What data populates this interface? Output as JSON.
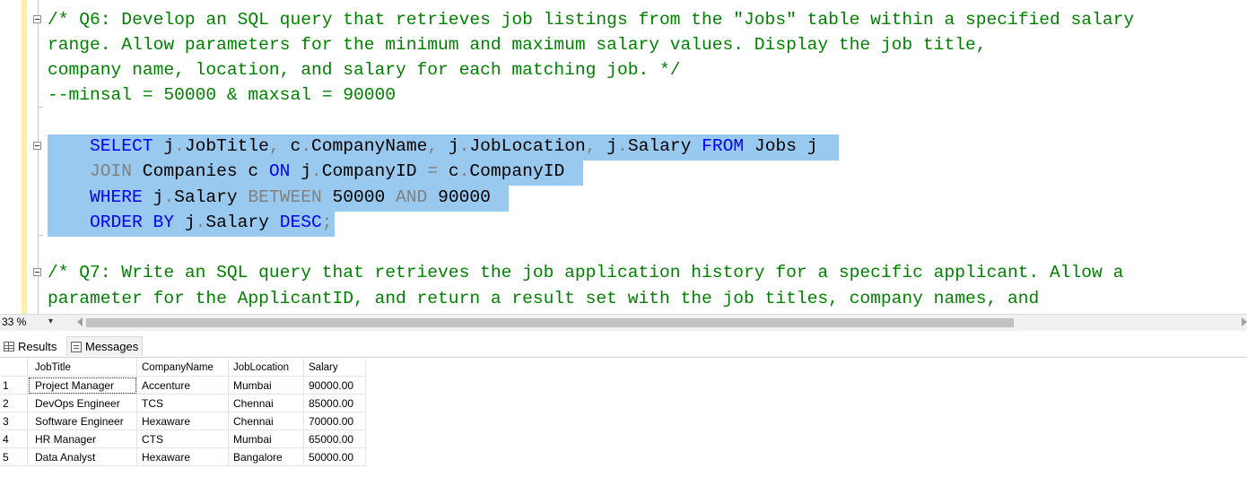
{
  "editor": {
    "q6_comment": [
      "/* Q6: Develop an SQL query that retrieves job listings from the \"Jobs\" table within a specified salary",
      "range. Allow parameters for the minimum and maximum salary values. Display the job title,",
      "company name, location, and salary for each matching job. */",
      "--minsal = 50000 & maxsal = 90000"
    ],
    "sql": {
      "l1": [
        "SELECT",
        " j",
        ".",
        "JobTitle",
        ",",
        " c",
        ".",
        "CompanyName",
        ",",
        " j",
        ".",
        "JobLocation",
        ",",
        " j",
        ".",
        "Salary ",
        "FROM",
        " Jobs j"
      ],
      "l2": [
        "JOIN",
        " Companies c ",
        "ON",
        " j",
        ".",
        "CompanyID ",
        "=",
        " c",
        ".",
        "CompanyID"
      ],
      "l3": [
        "WHERE",
        " j",
        ".",
        "Salary ",
        "BETWEEN",
        " 50000 ",
        "AND",
        " 90000"
      ],
      "l4": [
        "ORDER BY",
        " j",
        ".",
        "Salary ",
        "DESC",
        ";"
      ]
    },
    "q7_comment": [
      "/* Q7: Write an SQL query that retrieves the job application history for a specific applicant. Allow a",
      "parameter for the ApplicantID, and return a result set with the job titles, company names, and"
    ]
  },
  "zoom": {
    "level": "33 %",
    "dropdown": "▾"
  },
  "tabs": {
    "results": "Results",
    "messages": "Messages"
  },
  "grid": {
    "columns": [
      "JobTitle",
      "CompanyName",
      "JobLocation",
      "Salary"
    ],
    "rows": [
      {
        "n": "1",
        "title": "Project Manager",
        "company": "Accenture",
        "location": "Mumbai",
        "salary": "90000.00"
      },
      {
        "n": "2",
        "title": "DevOps Engineer",
        "company": "TCS",
        "location": "Chennai",
        "salary": "85000.00"
      },
      {
        "n": "3",
        "title": "Software Engineer",
        "company": "Hexaware",
        "location": "Chennai",
        "salary": "70000.00"
      },
      {
        "n": "4",
        "title": "HR Manager",
        "company": "CTS",
        "location": "Mumbai",
        "salary": "65000.00"
      },
      {
        "n": "5",
        "title": "Data Analyst",
        "company": "Hexaware",
        "location": "Bangalore",
        "salary": "50000.00"
      }
    ]
  },
  "icons": {
    "results": "grid-icon",
    "messages": "messages-icon",
    "fold": "collapse-icon"
  }
}
